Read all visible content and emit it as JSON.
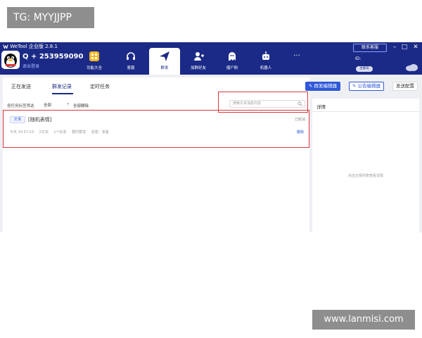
{
  "overlay": {
    "tg_badge": "TG: MYYJJPP",
    "site_badge": "www.lanmisi.com"
  },
  "titlebar": {
    "app_name": "WeTool 企业版 2.8.1",
    "account": "Q + 253959090",
    "logout": "退出登录",
    "contact": "联系客服",
    "status_label": "ID:",
    "status_pill": "主账号"
  },
  "nav": {
    "items": [
      {
        "label": "功能大全",
        "icon": "grid-icon"
      },
      {
        "label": "客服",
        "icon": "headset-icon"
      },
      {
        "label": "群发",
        "icon": "send-icon",
        "active": true
      },
      {
        "label": "加群好友",
        "icon": "add-user-icon"
      },
      {
        "label": "僵尸粉",
        "icon": "ghost-icon"
      },
      {
        "label": "机器人",
        "icon": "robot-icon"
      },
      {
        "label": "···",
        "icon": "more-icon"
      }
    ]
  },
  "tabs": [
    {
      "label": "正在发送"
    },
    {
      "label": "群发记录",
      "active": true
    },
    {
      "label": "定时任务"
    }
  ],
  "toolbar": {
    "group_editor": "群发编辑器",
    "notice_editor": "公告编辑器",
    "send_settings": "发送配置"
  },
  "filter": {
    "label": "按任务标签筛选",
    "select_value": "全部",
    "delete_all": "全部删除"
  },
  "search": {
    "placeholder": "搜索文本消息内容"
  },
  "record": {
    "type": "文本",
    "title": "[随机表情]",
    "status": "已取消",
    "meta": [
      "今天 20:57:23",
      "2文本",
      "1个好友",
      "群时群发",
      "标签：看客"
    ],
    "delete": "删除"
  },
  "right_panel": {
    "title": "详情",
    "empty": "点击左侧列表查看详情"
  },
  "colors": {
    "brand": "#1b2a86",
    "accent": "#2f58d8",
    "highlight": "#d9383c"
  }
}
